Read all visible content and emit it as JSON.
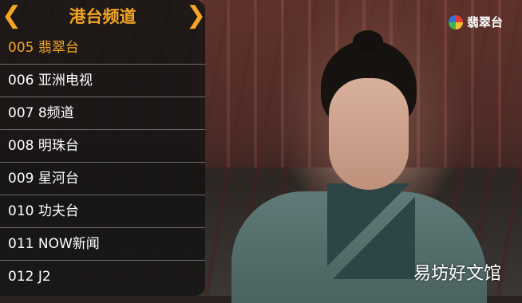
{
  "panel": {
    "title": "港台频道",
    "prev_arrow": "❮",
    "next_arrow": "❯",
    "channels": [
      {
        "label": "005 翡翠台",
        "selected": true
      },
      {
        "label": "006 亚洲电视"
      },
      {
        "label": "007 8频道"
      },
      {
        "label": "008 明珠台"
      },
      {
        "label": "009 星河台"
      },
      {
        "label": "010 功夫台"
      },
      {
        "label": "011 NOW新闻"
      },
      {
        "label": "012 J2"
      }
    ]
  },
  "broadcaster_logo": {
    "text": "翡翠台",
    "icon": "tvb-logo-icon"
  },
  "watermark": "易坊好文馆",
  "colors": {
    "accent": "#f5a623",
    "panel_bg": "rgba(18,18,18,0.82)",
    "divider": "#6c6c6c"
  }
}
